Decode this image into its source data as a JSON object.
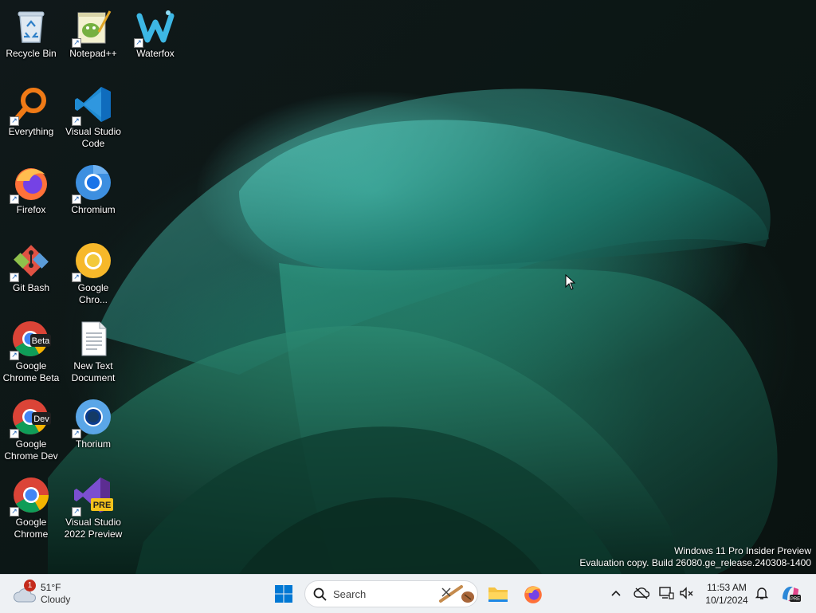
{
  "desktop": {
    "icons": [
      {
        "label_lines": [
          "Recycle Bin"
        ],
        "icon": "recycle-bin-icon"
      },
      {
        "label_lines": [
          "Notepad++"
        ],
        "icon": "notepad-plus-plus-icon"
      },
      {
        "label_lines": [
          "Waterfox"
        ],
        "icon": "waterfox-icon"
      },
      {
        "label_lines": [
          "Everything"
        ],
        "icon": "everything-search-icon"
      },
      {
        "label_lines": [
          "Visual Studio",
          "Code"
        ],
        "icon": "vscode-icon"
      },
      {
        "label_lines": [
          "Firefox"
        ],
        "icon": "firefox-icon"
      },
      {
        "label_lines": [
          "Chromium"
        ],
        "icon": "chromium-icon"
      },
      {
        "label_lines": [
          "Git Bash"
        ],
        "icon": "git-bash-icon"
      },
      {
        "label_lines": [
          "Google",
          "Chro..."
        ],
        "icon": "chrome-canary-icon"
      },
      {
        "label_lines": [
          "Google",
          "Chrome Beta"
        ],
        "icon": "chrome-beta-icon",
        "badge": "Beta"
      },
      {
        "label_lines": [
          "New Text",
          "Document"
        ],
        "icon": "text-document-icon"
      },
      {
        "label_lines": [
          "Google",
          "Chrome Dev"
        ],
        "icon": "chrome-dev-icon",
        "badge": "Dev"
      },
      {
        "label_lines": [
          "Thorium"
        ],
        "icon": "thorium-icon"
      },
      {
        "label_lines": [
          "Google",
          "Chrome"
        ],
        "icon": "chrome-icon"
      },
      {
        "label_lines": [
          "Visual Studio",
          "2022 Preview"
        ],
        "icon": "visual-studio-preview-icon",
        "badge": "PRE"
      }
    ]
  },
  "watermark": {
    "line1": "Windows 11 Pro Insider Preview",
    "line2": "Evaluation copy. Build 26080.ge_release.240308-1400"
  },
  "taskbar": {
    "weather": {
      "temp": "51°F",
      "condition": "Cloudy",
      "badge_count": "1"
    },
    "search_placeholder": "Search",
    "clock": {
      "time": "11:53 AM",
      "date": "10/1/2024"
    },
    "colors": {
      "accent": "#0078d4",
      "background": "#eef1f4"
    }
  }
}
